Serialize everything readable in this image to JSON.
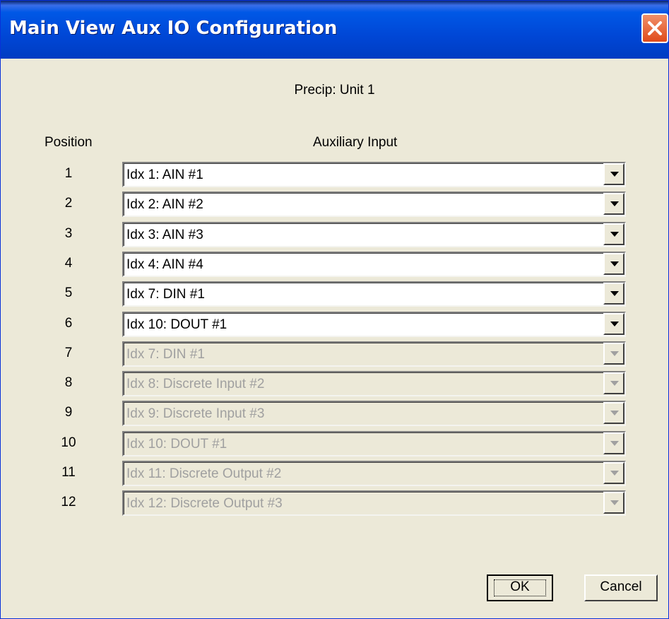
{
  "window": {
    "title": "Main View Aux IO Configuration",
    "close_icon": "close-icon",
    "accent_color": "#0058e6",
    "close_color": "#e04a1a"
  },
  "dialog": {
    "subtitle": "Precip: Unit 1",
    "column_headers": {
      "position": "Position",
      "aux_input": "Auxiliary Input"
    },
    "rows": [
      {
        "position": "1",
        "value": "Idx 1: AIN #1",
        "enabled": true
      },
      {
        "position": "2",
        "value": "Idx 2: AIN #2",
        "enabled": true
      },
      {
        "position": "3",
        "value": "Idx 3: AIN #3",
        "enabled": true
      },
      {
        "position": "4",
        "value": "Idx 4: AIN #4",
        "enabled": true
      },
      {
        "position": "5",
        "value": "Idx 7: DIN #1",
        "enabled": true
      },
      {
        "position": "6",
        "value": "Idx 10: DOUT #1",
        "enabled": true
      },
      {
        "position": "7",
        "value": "Idx 7: DIN #1",
        "enabled": false
      },
      {
        "position": "8",
        "value": "Idx 8: Discrete Input #2",
        "enabled": false
      },
      {
        "position": "9",
        "value": "Idx 9: Discrete Input #3",
        "enabled": false
      },
      {
        "position": "10",
        "value": "Idx 10: DOUT #1",
        "enabled": false
      },
      {
        "position": "11",
        "value": "Idx 11: Discrete Output #2",
        "enabled": false
      },
      {
        "position": "12",
        "value": "Idx 12: Discrete Output #3",
        "enabled": false
      }
    ],
    "dropdown_icon": "chevron-down-icon"
  },
  "buttons": {
    "ok_label": "OK",
    "cancel_label": "Cancel"
  }
}
